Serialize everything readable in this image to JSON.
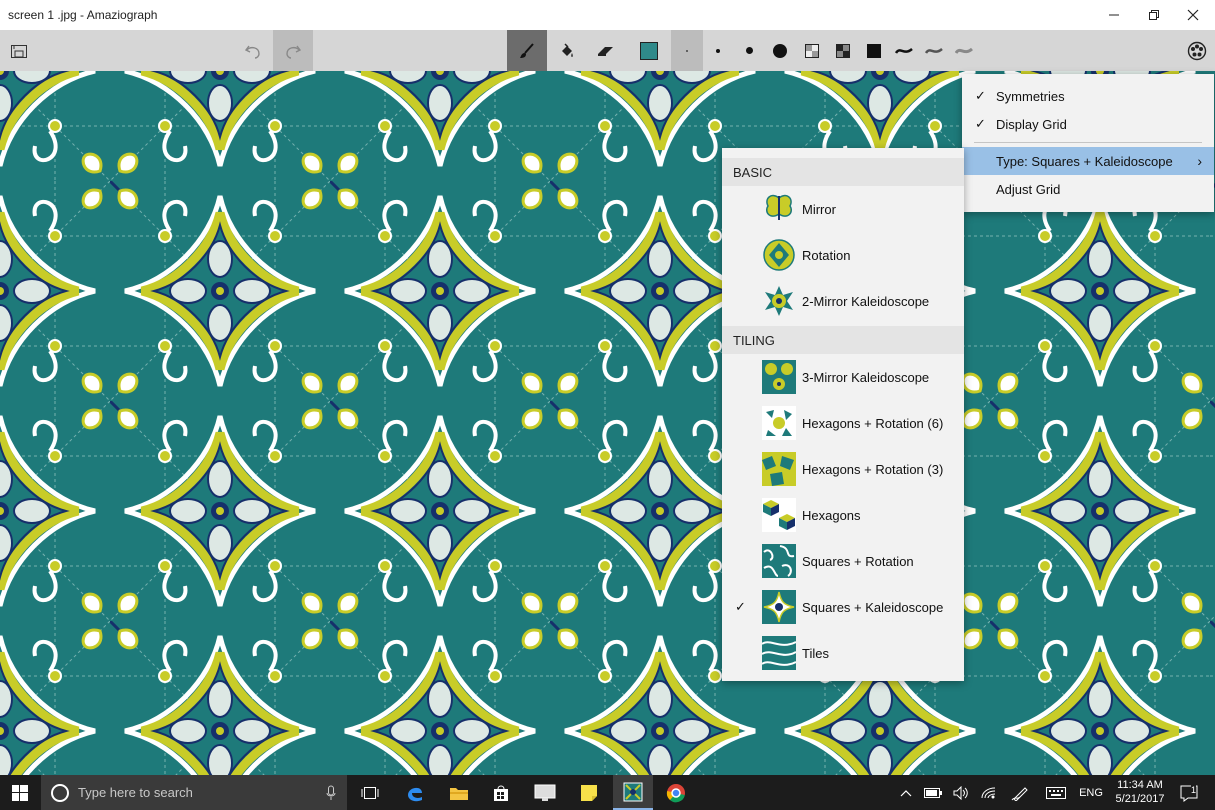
{
  "window": {
    "title": "screen 1 .jpg - Amaziograph",
    "minimize_icon": "minimize-icon",
    "maximize_icon": "restore-icon",
    "close_icon": "close-icon"
  },
  "toolbar": {
    "tools": [
      "save",
      "undo",
      "redo",
      "brush",
      "fill",
      "eraser",
      "color-swatch"
    ],
    "current_color": "#2f8a8a",
    "brush_sizes": 5,
    "opacity_options": 3,
    "stroke_styles": 3
  },
  "settings_menu": {
    "items": [
      {
        "label": "Symmetries",
        "checked": true
      },
      {
        "label": "Display Grid",
        "checked": true
      },
      {
        "label": "Type: Squares + Kaleidoscope",
        "submenu": true,
        "highlighted": true
      },
      {
        "label": "Adjust Grid"
      }
    ]
  },
  "type_menu": {
    "basic_header": "BASIC",
    "basic_items": [
      {
        "label": "Mirror",
        "icon": "butterfly-icon"
      },
      {
        "label": "Rotation",
        "icon": "rotation-icon"
      },
      {
        "label": "2-Mirror Kaleidoscope",
        "icon": "kaleidoscope-icon"
      }
    ],
    "tiling_header": "TILING",
    "tiling_items": [
      {
        "label": "3-Mirror Kaleidoscope"
      },
      {
        "label": "Hexagons + Rotation (6)"
      },
      {
        "label": "Hexagons + Rotation (3)"
      },
      {
        "label": "Hexagons"
      },
      {
        "label": "Squares + Rotation"
      },
      {
        "label": "Squares + Kaleidoscope",
        "checked": true
      },
      {
        "label": "Tiles"
      }
    ]
  },
  "taskbar": {
    "search_placeholder": "Type here to search",
    "language": "ENG",
    "time": "11:34 AM",
    "date": "5/21/2017",
    "notification_count": "1"
  },
  "colors": {
    "teal": "#1e7a7a",
    "yellow": "#c8cc28",
    "navy": "#16306b",
    "highlight": "#99c0e6"
  }
}
